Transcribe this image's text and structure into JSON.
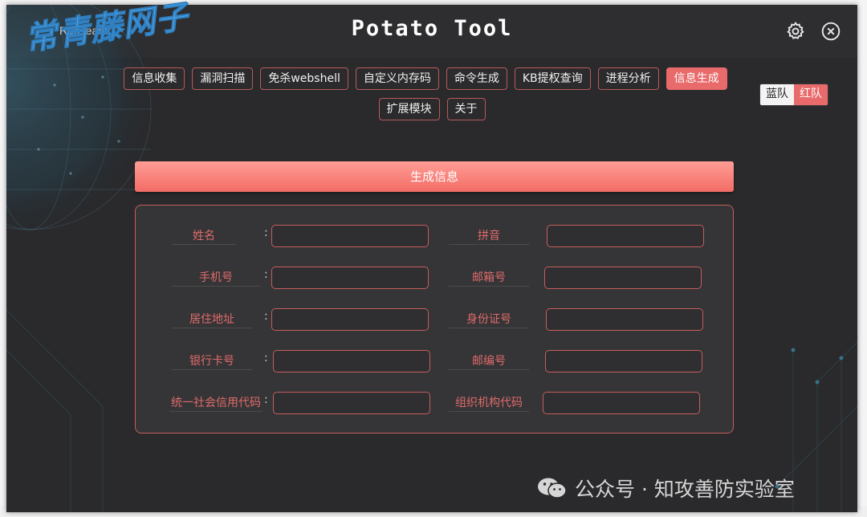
{
  "window": {
    "brand": "RedTeam",
    "title": "Potato Tool"
  },
  "icons": {
    "settings": "gear-icon",
    "close": "close-circle-icon"
  },
  "nav": {
    "row1": [
      "信息收集",
      "漏洞扫描",
      "免杀webshell",
      "自定义内存码",
      "命令生成",
      "KB提权查询",
      "进程分析",
      "信息生成"
    ],
    "row2": [
      "扩展模块",
      "关于"
    ],
    "active": "信息生成"
  },
  "team": {
    "blue": "蓝队",
    "red": "红队",
    "selected": "红队"
  },
  "generate_button": "生成信息",
  "form": {
    "name": {
      "label": "姓名",
      "value": ""
    },
    "pinyin": {
      "label": "拼音",
      "value": ""
    },
    "phone": {
      "label": "手机号",
      "value": ""
    },
    "email": {
      "label": "邮箱号",
      "value": ""
    },
    "address": {
      "label": "居住地址",
      "value": ""
    },
    "id_number": {
      "label": "身份证号",
      "value": ""
    },
    "bank_card": {
      "label": "银行卡号",
      "value": ""
    },
    "postal_code": {
      "label": "邮编号",
      "value": ""
    },
    "credit_code": {
      "label": "统一社会信用代码",
      "value": ""
    },
    "org_code": {
      "label": "组织机构代码",
      "value": ""
    }
  },
  "colon": ":",
  "watermarks": {
    "top": "常青藤网子",
    "bottom": "公众号 · 知攻善防实验室"
  },
  "colors": {
    "accent": "#e86a6a",
    "button_top": "#ff9d95",
    "button_bottom": "#f26c66",
    "window_bg": "#2a2a2c",
    "label": "#e06a6a"
  }
}
